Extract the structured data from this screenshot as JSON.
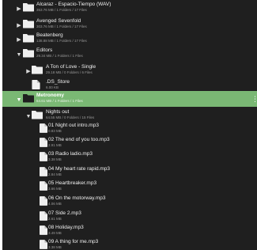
{
  "items": [
    {
      "name": "Alcaraz - Espacio-Tiempo (WAV)",
      "meta": "353.76 MB / 1 Folders / 17 Files",
      "type": "folder",
      "state": "collapsed"
    },
    {
      "name": "Avenged Sevenfold",
      "meta": "303.76 MB / 1 Folders / 17 Files",
      "type": "folder",
      "state": "collapsed"
    },
    {
      "name": "Beatenberg",
      "meta": "138.88 MB / 1 Folders / 17 Files",
      "type": "folder",
      "state": "collapsed"
    },
    {
      "name": "Editors",
      "meta": "29.34 MB / 1 Folders / 1 Files",
      "type": "folder",
      "state": "expanded"
    },
    {
      "name": "A Ton of Love - Single",
      "meta": "29.18 MB / 0 Folders / 6 Files",
      "type": "folder",
      "state": "collapsed"
    },
    {
      "name": ".DS_Store",
      "meta": "6.00 KB",
      "type": "file"
    },
    {
      "name": "Metronomy",
      "meta": "64.61 MB / 1 Folders / 1 Files",
      "type": "folder",
      "state": "expanded",
      "selected": true
    },
    {
      "name": "Nights out",
      "meta": "64.55 MB / 0 Folders / 15 Files",
      "type": "folder",
      "state": "expanded"
    },
    {
      "name": "01 Night out intro.mp3",
      "meta": "0.83 MB",
      "type": "file"
    },
    {
      "name": "02 The end of you too.mp3",
      "meta": "2.91 MB",
      "type": "file"
    },
    {
      "name": "03 Radio ladio.mp3",
      "meta": "3.38 MB",
      "type": "file"
    },
    {
      "name": "04 My heart rate rapid.mp3",
      "meta": "2.84 MB",
      "type": "file"
    },
    {
      "name": "05 Heartbreaker.mp3",
      "meta": "3.66 MB",
      "type": "file"
    },
    {
      "name": "06 On the motorway.mp3",
      "meta": "4.06 MB",
      "type": "file"
    },
    {
      "name": "07 Side 2.mp3",
      "meta": "2.61 MB",
      "type": "file"
    },
    {
      "name": "08 Holiday.mp3",
      "meta": "3.49 MB",
      "type": "file"
    },
    {
      "name": "09 A thing for me.mp3",
      "meta": "3.38 MB",
      "type": "file"
    }
  ],
  "icons": {
    "folder": "folder-icon",
    "file": "file-icon",
    "expanded": "chevron-down-icon",
    "collapsed": "chevron-right-icon",
    "menu": "more-vertical-icon"
  },
  "colors": {
    "background": "#1f1f1f",
    "selected_row": "#7ab874",
    "text": "#f0f0f0",
    "meta": "#9a9a9a"
  }
}
